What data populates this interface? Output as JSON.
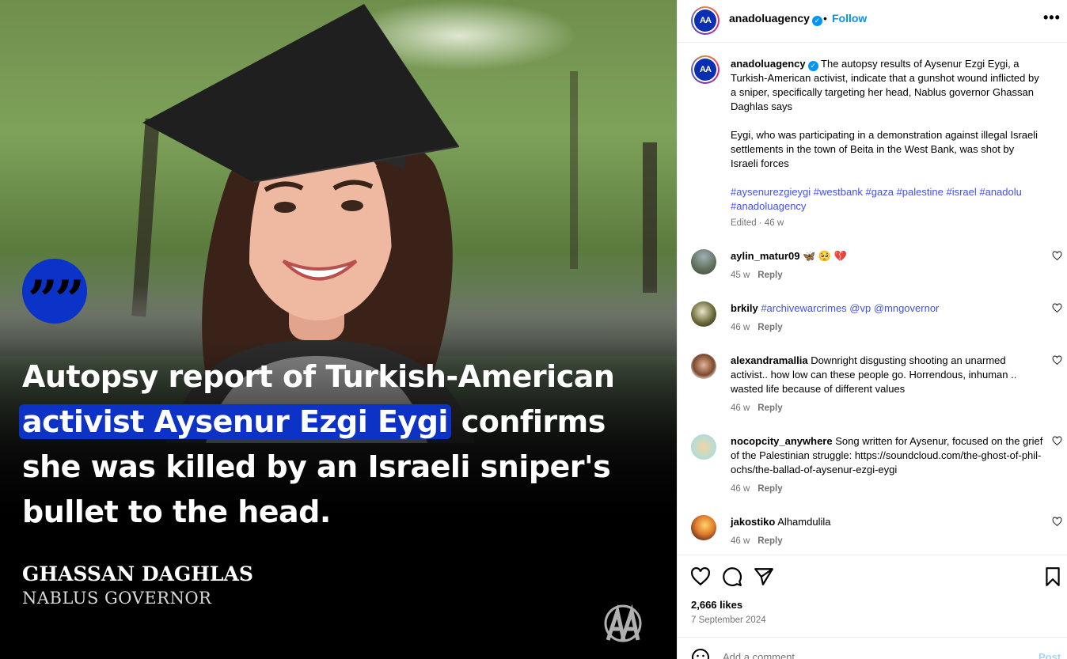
{
  "media": {
    "headline_pre": "Autopsy report of Turkish-American",
    "headline_highlight": "activist Aysenur Ezgi Eygi",
    "headline_mid": "confirms",
    "headline_line3": "she was killed by an Israeli sniper's",
    "headline_line4": "bullet to the head.",
    "quote_mark": "”",
    "speaker_name": "GHASSAN DAGHLAS",
    "speaker_role": "NABLUS GOVERNOR",
    "logo_icon": "aa-logo-icon",
    "accent_color": "#0d32c6"
  },
  "header": {
    "username": "anadoluagency",
    "separator": "•",
    "follow_label": "Follow",
    "more_icon": "more-options-icon",
    "more_glyph": "•••",
    "avatar_text": "AA"
  },
  "caption": {
    "username": "anadoluagency",
    "text1": "The autopsy results of Aysenur Ezgi Eygi, a Turkish-American activist, indicate that a gunshot wound inflicted by a sniper, specifically targeting her head, Nablus governor Ghassan Daghlas says",
    "text2": "Eygi, who was participating in a demonstration against illegal Israeli settlements in the town of Beita in the West Bank, was shot by Israeli forces",
    "hashtags": "#aysenurezgieygi #westbank #gaza #palestine #israel #anadolu #anadoluagency",
    "meta": "Edited · 46 w"
  },
  "comments": [
    {
      "username": "aylin_matur09",
      "text": "🦋 🥺 💔",
      "time": "45 w",
      "reply": "Reply"
    },
    {
      "username": "brkily",
      "text": "#archivewarcrimes @vp @mngovernor",
      "time": "46 w",
      "reply": "Reply"
    },
    {
      "username": "alexandramallia",
      "text": "Downright disgusting shooting an unarmed activist.. how low can these people go. Horrendous, inhuman .. wasted life because of different values",
      "time": "46 w",
      "reply": "Reply"
    },
    {
      "username": "nocopcity_anywhere",
      "text": "Song written for Aysenur, focused on the grief of the Palestinian struggle: https://soundcloud.com/the-ghost-of-phil-ochs/the-ballad-of-aysenur-ezgi-eygi",
      "time": "46 w",
      "reply": "Reply"
    },
    {
      "username": "jakostiko",
      "text": "Alhamdulila",
      "time": "46 w",
      "reply": "Reply"
    }
  ],
  "actions": {
    "likes": "2,666 likes",
    "date": "7 September 2024"
  },
  "add_comment": {
    "placeholder": "Add a comment...",
    "post_label": "Post"
  }
}
